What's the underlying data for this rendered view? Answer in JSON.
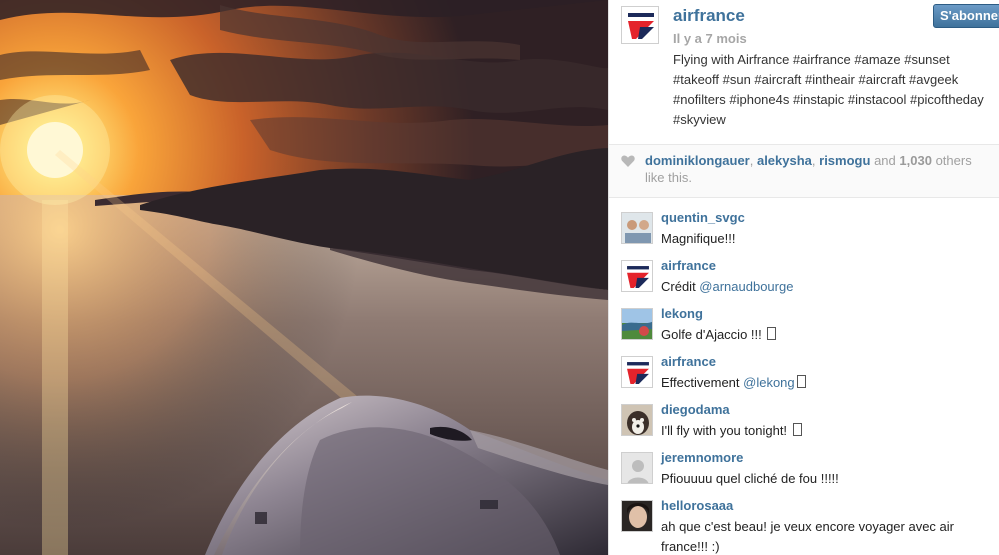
{
  "post": {
    "owner": "airfrance",
    "time_ago": "Il y a 7 mois",
    "caption": "Flying with Airfrance #airfrance #amaze #sunset #takeoff #sun #aircraft #intheair #aircraft #avgeek #nofilters #iphone4s #instapic #instacool #picoftheday #skyview",
    "follow_label": "S'abonner"
  },
  "likes": {
    "user1": "dominiklongauer",
    "user2": "alekysha",
    "user3": "rismogu",
    "and": "and",
    "count": "1,030",
    "suffix": "others like this."
  },
  "comments": [
    {
      "user": "quentin_svgc",
      "text": "Magnifique!!!",
      "avatar": "person-avatar"
    },
    {
      "user": "airfrance",
      "text": "Crédit ",
      "mention": "@arnaudbourge",
      "avatar": "airfrance-logo"
    },
    {
      "user": "lekong",
      "text": "Golfe d'Ajaccio !!! ",
      "avatar": "landscape-avatar"
    },
    {
      "user": "airfrance",
      "text": "Effectivement ",
      "mention": "@lekong",
      "avatar": "airfrance-logo"
    },
    {
      "user": "diegodama",
      "text": "I'll fly with you tonight! ",
      "avatar": "dog-avatar"
    },
    {
      "user": "jeremnomore",
      "text": "Pfiouuuu quel cliché de fou !!!!!",
      "avatar": "default-avatar"
    },
    {
      "user": "hellorosaaa",
      "text": "ah que c'est beau! je veux encore voyager avec air france!!! :)",
      "avatar": "person-avatar"
    }
  ],
  "colors": {
    "link": "#3f729b",
    "button": "#3f729b",
    "airfrance_red": "#e4232b",
    "airfrance_navy": "#1c2a5a"
  }
}
